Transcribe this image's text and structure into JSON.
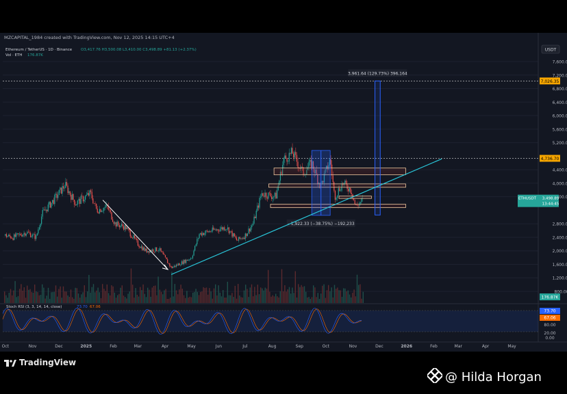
{
  "header": {
    "credit": "MZCAPITAL_1984 created with TradingView.com, Nov 12, 2025 14:15 UTC+4"
  },
  "chart_data": {
    "type": "candlestick",
    "symbol": "Ethereum / TetherUS · 1D · Binance",
    "ohlc_label": "O3,417.76 H3,500.08 L3,410.00 C3,498.89 +81.13 (+2.37%)",
    "volume_label": "Vol · ETH",
    "volume_value": "176.87K",
    "currency": "USDT",
    "y_ticks": [
      7600,
      7200,
      6800,
      6400,
      6000,
      5600,
      5200,
      4400,
      4000,
      3600,
      2800,
      2400,
      2000,
      1600,
      1200,
      800
    ],
    "y_tick_labels": [
      "7,600.00",
      "7,200.00",
      "6,800.00",
      "6,400.00",
      "6,000.00",
      "5,600.00",
      "5,200.00",
      "4,400.00",
      "4,000.00",
      "3,600.00",
      "2,800.00",
      "2,400.00",
      "2,000.00",
      "1,600.00",
      "1,200.00",
      "800.00"
    ],
    "x_tick_labels": [
      "Oct",
      "Nov",
      "Dec",
      "2025",
      "Feb",
      "Mar",
      "Apr",
      "May",
      "Jun",
      "Jul",
      "Aug",
      "Sep",
      "Oct",
      "Nov",
      "Dec",
      "2026",
      "Feb",
      "Mar",
      "Apr",
      "May"
    ],
    "price_path": [
      [
        "2024-10-01",
        2450
      ],
      [
        "2024-10-10",
        2400
      ],
      [
        "2024-10-25",
        2550
      ],
      [
        "2024-11-05",
        2400
      ],
      [
        "2024-11-12",
        3100
      ],
      [
        "2024-11-25",
        3500
      ],
      [
        "2024-12-08",
        3950
      ],
      [
        "2024-12-20",
        3400
      ],
      [
        "2025-01-06",
        3700
      ],
      [
        "2025-01-13",
        3200
      ],
      [
        "2025-01-25",
        3300
      ],
      [
        "2025-02-03",
        2800
      ],
      [
        "2025-02-15",
        2700
      ],
      [
        "2025-03-01",
        2200
      ],
      [
        "2025-03-10",
        2000
      ],
      [
        "2025-03-25",
        2050
      ],
      [
        "2025-04-08",
        1500
      ],
      [
        "2025-04-20",
        1650
      ],
      [
        "2025-05-01",
        1800
      ],
      [
        "2025-05-10",
        2500
      ],
      [
        "2025-05-25",
        2600
      ],
      [
        "2025-06-10",
        2700
      ],
      [
        "2025-06-22",
        2300
      ],
      [
        "2025-07-01",
        2450
      ],
      [
        "2025-07-10",
        2800
      ],
      [
        "2025-07-20",
        3700
      ],
      [
        "2025-08-05",
        3600
      ],
      [
        "2025-08-14",
        4700
      ],
      [
        "2025-08-24",
        4900
      ],
      [
        "2025-09-05",
        4300
      ],
      [
        "2025-09-15",
        4600
      ],
      [
        "2025-09-25",
        3900
      ],
      [
        "2025-10-06",
        4700
      ],
      [
        "2025-10-11",
        3600
      ],
      [
        "2025-10-20",
        4000
      ],
      [
        "2025-10-30",
        3800
      ],
      [
        "2025-11-04",
        3300
      ],
      [
        "2025-11-12",
        3499
      ]
    ],
    "levels": [
      {
        "label": "7,026.35",
        "price": 7026.35,
        "color": "#f7a600"
      },
      {
        "label": "4,736.70",
        "price": 4736.7,
        "color": "#f7a600"
      }
    ],
    "last_price_label": "3,498.89",
    "last_price_symbol": "ETHUSDT",
    "countdown": "13:44:45",
    "volume_badge": "176.87K",
    "zones": [
      {
        "from": 4250,
        "to": 4450
      },
      {
        "from": 3880,
        "to": 3980
      },
      {
        "from": 3550,
        "to": 3620
      },
      {
        "from": 3280,
        "to": 3380
      }
    ],
    "measurements": [
      {
        "label": "3,961.64 (129.73%) 396,164",
        "from": 3060,
        "to": 7026.35
      },
      {
        "label": "−1,922.33 (−38.75%) −192,233",
        "from": 4970,
        "to": 3050
      }
    ],
    "indicator": {
      "label": "Stoch RSI (3, 3, 14, 14, close)",
      "k_value": "73.70",
      "d_value": "67.06",
      "k_label": "73.70",
      "d_label": "67.06",
      "k_color": "#2962ff",
      "d_color": "#ff6d00",
      "ticks": [
        "80.00",
        "20.00",
        "0.00"
      ]
    }
  },
  "footer": {
    "brand": "TradingView",
    "watermark": "@ Hilda Horgan"
  }
}
